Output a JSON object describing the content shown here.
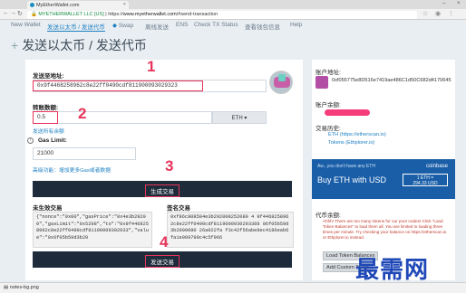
{
  "browser": {
    "tab_title": "MyEtherWallet.com",
    "url_secure": "MYETHERWALLET LLC [US]",
    "url_prefix": "https://",
    "url_host": "www.myetherwallet.com",
    "url_path": "/#send-transaction"
  },
  "site_nav": {
    "items": [
      "New Wallet",
      "发送以太币 / 发送代币",
      "Swap",
      "离线发送",
      "ENS",
      "Check TX Status",
      "查看钱包信息",
      "Help"
    ],
    "active_index": 1
  },
  "page_title": "发送以太币 / 发送代币",
  "form": {
    "to_label": "发送至地址:",
    "to_value": "0x9f4468258962c8e22ff0490cdf811900093029323",
    "amount_label": "转账数额:",
    "amount_value": "0.5",
    "unit": "ETH",
    "send_all_link": "发送所有余额",
    "gas_label": "Gas Limit:",
    "gas_value": "21000",
    "advanced_link": "高级功能：增加更多Gas或者数据",
    "generate_button": "生成交易",
    "raw_label": "未生效交易",
    "raw_value": "{\"nonce\":\"0x00\",\"gasPrice\":\"0x4e3b29200\",\"gasLimit\":\"0x5208\",\"to\":\"0x9f4468258962c8e22ff0490cdf81190009302933\",\"value\":\"0x6f05b59d3b20",
    "signed_label": "签名交易",
    "signed_value": "0xf86c808504e3b292008252089 4 9f4468258962c8e22ff0490cdf8119000930293388 06f05b59d3b2000080 26a022fa f3c42f56abe9ec4186eab6fa1e909799c4c5f966",
    "send_button": "发送交易"
  },
  "annotations": [
    "1",
    "2",
    "3",
    "4"
  ],
  "side": {
    "address_label": "账户地址:",
    "address_value": "0xf055775e8D516e7419ae486C1d50C682d4170645",
    "balance_label": "账户余额:",
    "history_label": "交易历史:",
    "history_links": [
      "ETH (https://etherscan.io)",
      "Tokens (Ethplorer.io)"
    ],
    "coinbase_small": "Aw...you don't have any ETH",
    "coinbase_buy": "Buy ETH with USD",
    "coinbase_brand": "coinbase",
    "coinbase_price_1": "1 ETH =",
    "coinbase_price_2": "294.33 USD",
    "tokens_label": "代币余额:",
    "tokens_warning": "Ahhh! There are too many tokens for our poor nodes! Click \"Load Token Balances\" to load them all. You are limited to loading three times per minute. Try checking your balance on https://etherscan.io or Ethplorer.io instead.",
    "load_tokens_button": "Load Token Balances",
    "add_token_button": "Add Custom Token"
  },
  "watermark": "最需网",
  "downloads": {
    "file": "notes-bg.png"
  },
  "colors": {
    "accent_pink": "#e8345b",
    "link_blue": "#1b7fc2",
    "dark_button": "#1d2b3a",
    "coinbase_blue": "#1a5ea8"
  }
}
